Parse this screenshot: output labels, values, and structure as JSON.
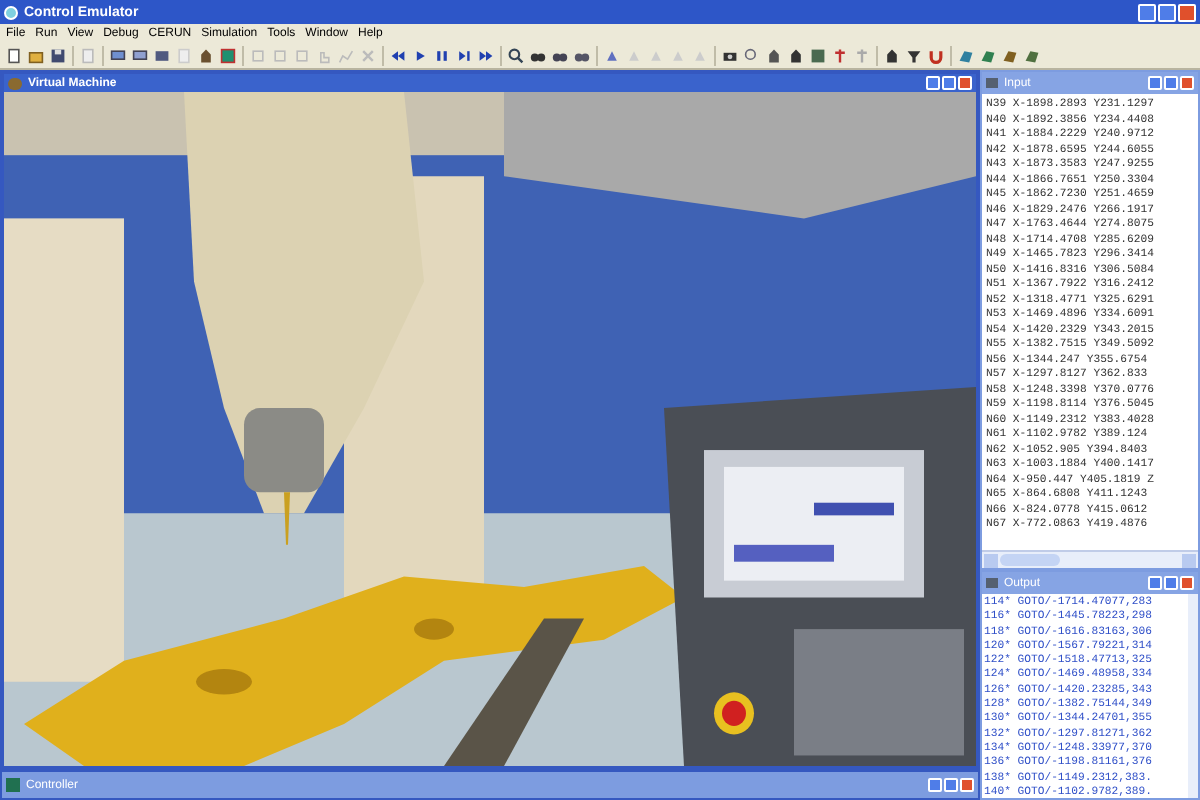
{
  "window": {
    "title": "Control Emulator"
  },
  "menu": [
    "File",
    "Run",
    "View",
    "Debug",
    "CERUN",
    "Simulation",
    "Tools",
    "Window",
    "Help"
  ],
  "virtual_machine": {
    "title": "Virtual Machine"
  },
  "input": {
    "title": "Input",
    "lines": [
      "N39 X-1898.2893 Y231.1297",
      "N40 X-1892.3856 Y234.4408",
      "N41 X-1884.2229 Y240.9712",
      "N42 X-1878.6595 Y244.6055",
      "N43 X-1873.3583 Y247.9255",
      "N44 X-1866.7651 Y250.3304",
      "N45 X-1862.7230 Y251.4659",
      "N46 X-1829.2476 Y266.1917",
      "N47 X-1763.4644 Y274.8075",
      "N48 X-1714.4708 Y285.6209",
      "N49 X-1465.7823 Y296.3414",
      "N50 X-1416.8316 Y306.5084",
      "N51 X-1367.7922 Y316.2412",
      "N52 X-1318.4771 Y325.6291",
      "N53 X-1469.4896 Y334.6091",
      "N54 X-1420.2329 Y343.2015",
      "N55 X-1382.7515 Y349.5092",
      "N56 X-1344.247 Y355.6754",
      "N57 X-1297.8127 Y362.833",
      "N58 X-1248.3398 Y370.0776",
      "N59 X-1198.8114 Y376.5045",
      "N60 X-1149.2312 Y383.4028",
      "N61 X-1102.9782 Y389.124",
      "N62 X-1052.905 Y394.8403",
      "N63 X-1003.1884 Y400.1417",
      "N64 X-950.447 Y405.1819 Z",
      "N65 X-864.6808 Y411.1243",
      "N66 X-824.0778 Y415.0612",
      "N67 X-772.0863 Y419.4876"
    ]
  },
  "output": {
    "title": "Output",
    "lines": [
      "114* GOTO/-1714.47077,283",
      "116* GOTO/-1445.78223,298",
      "118* GOTO/-1616.83163,306",
      "120* GOTO/-1567.79221,314",
      "122* GOTO/-1518.47713,325",
      "124* GOTO/-1469.48958,334",
      "126* GOTO/-1420.23285,343",
      "128* GOTO/-1382.75144,349",
      "130* GOTO/-1344.24701,355",
      "132* GOTO/-1297.81271,362",
      "134* GOTO/-1248.33977,370",
      "136* GOTO/-1198.81161,376",
      "138* GOTO/-1149.2312,383.",
      "140* GOTO/-1102.9782,389."
    ]
  },
  "controller": {
    "title": "Controller"
  }
}
